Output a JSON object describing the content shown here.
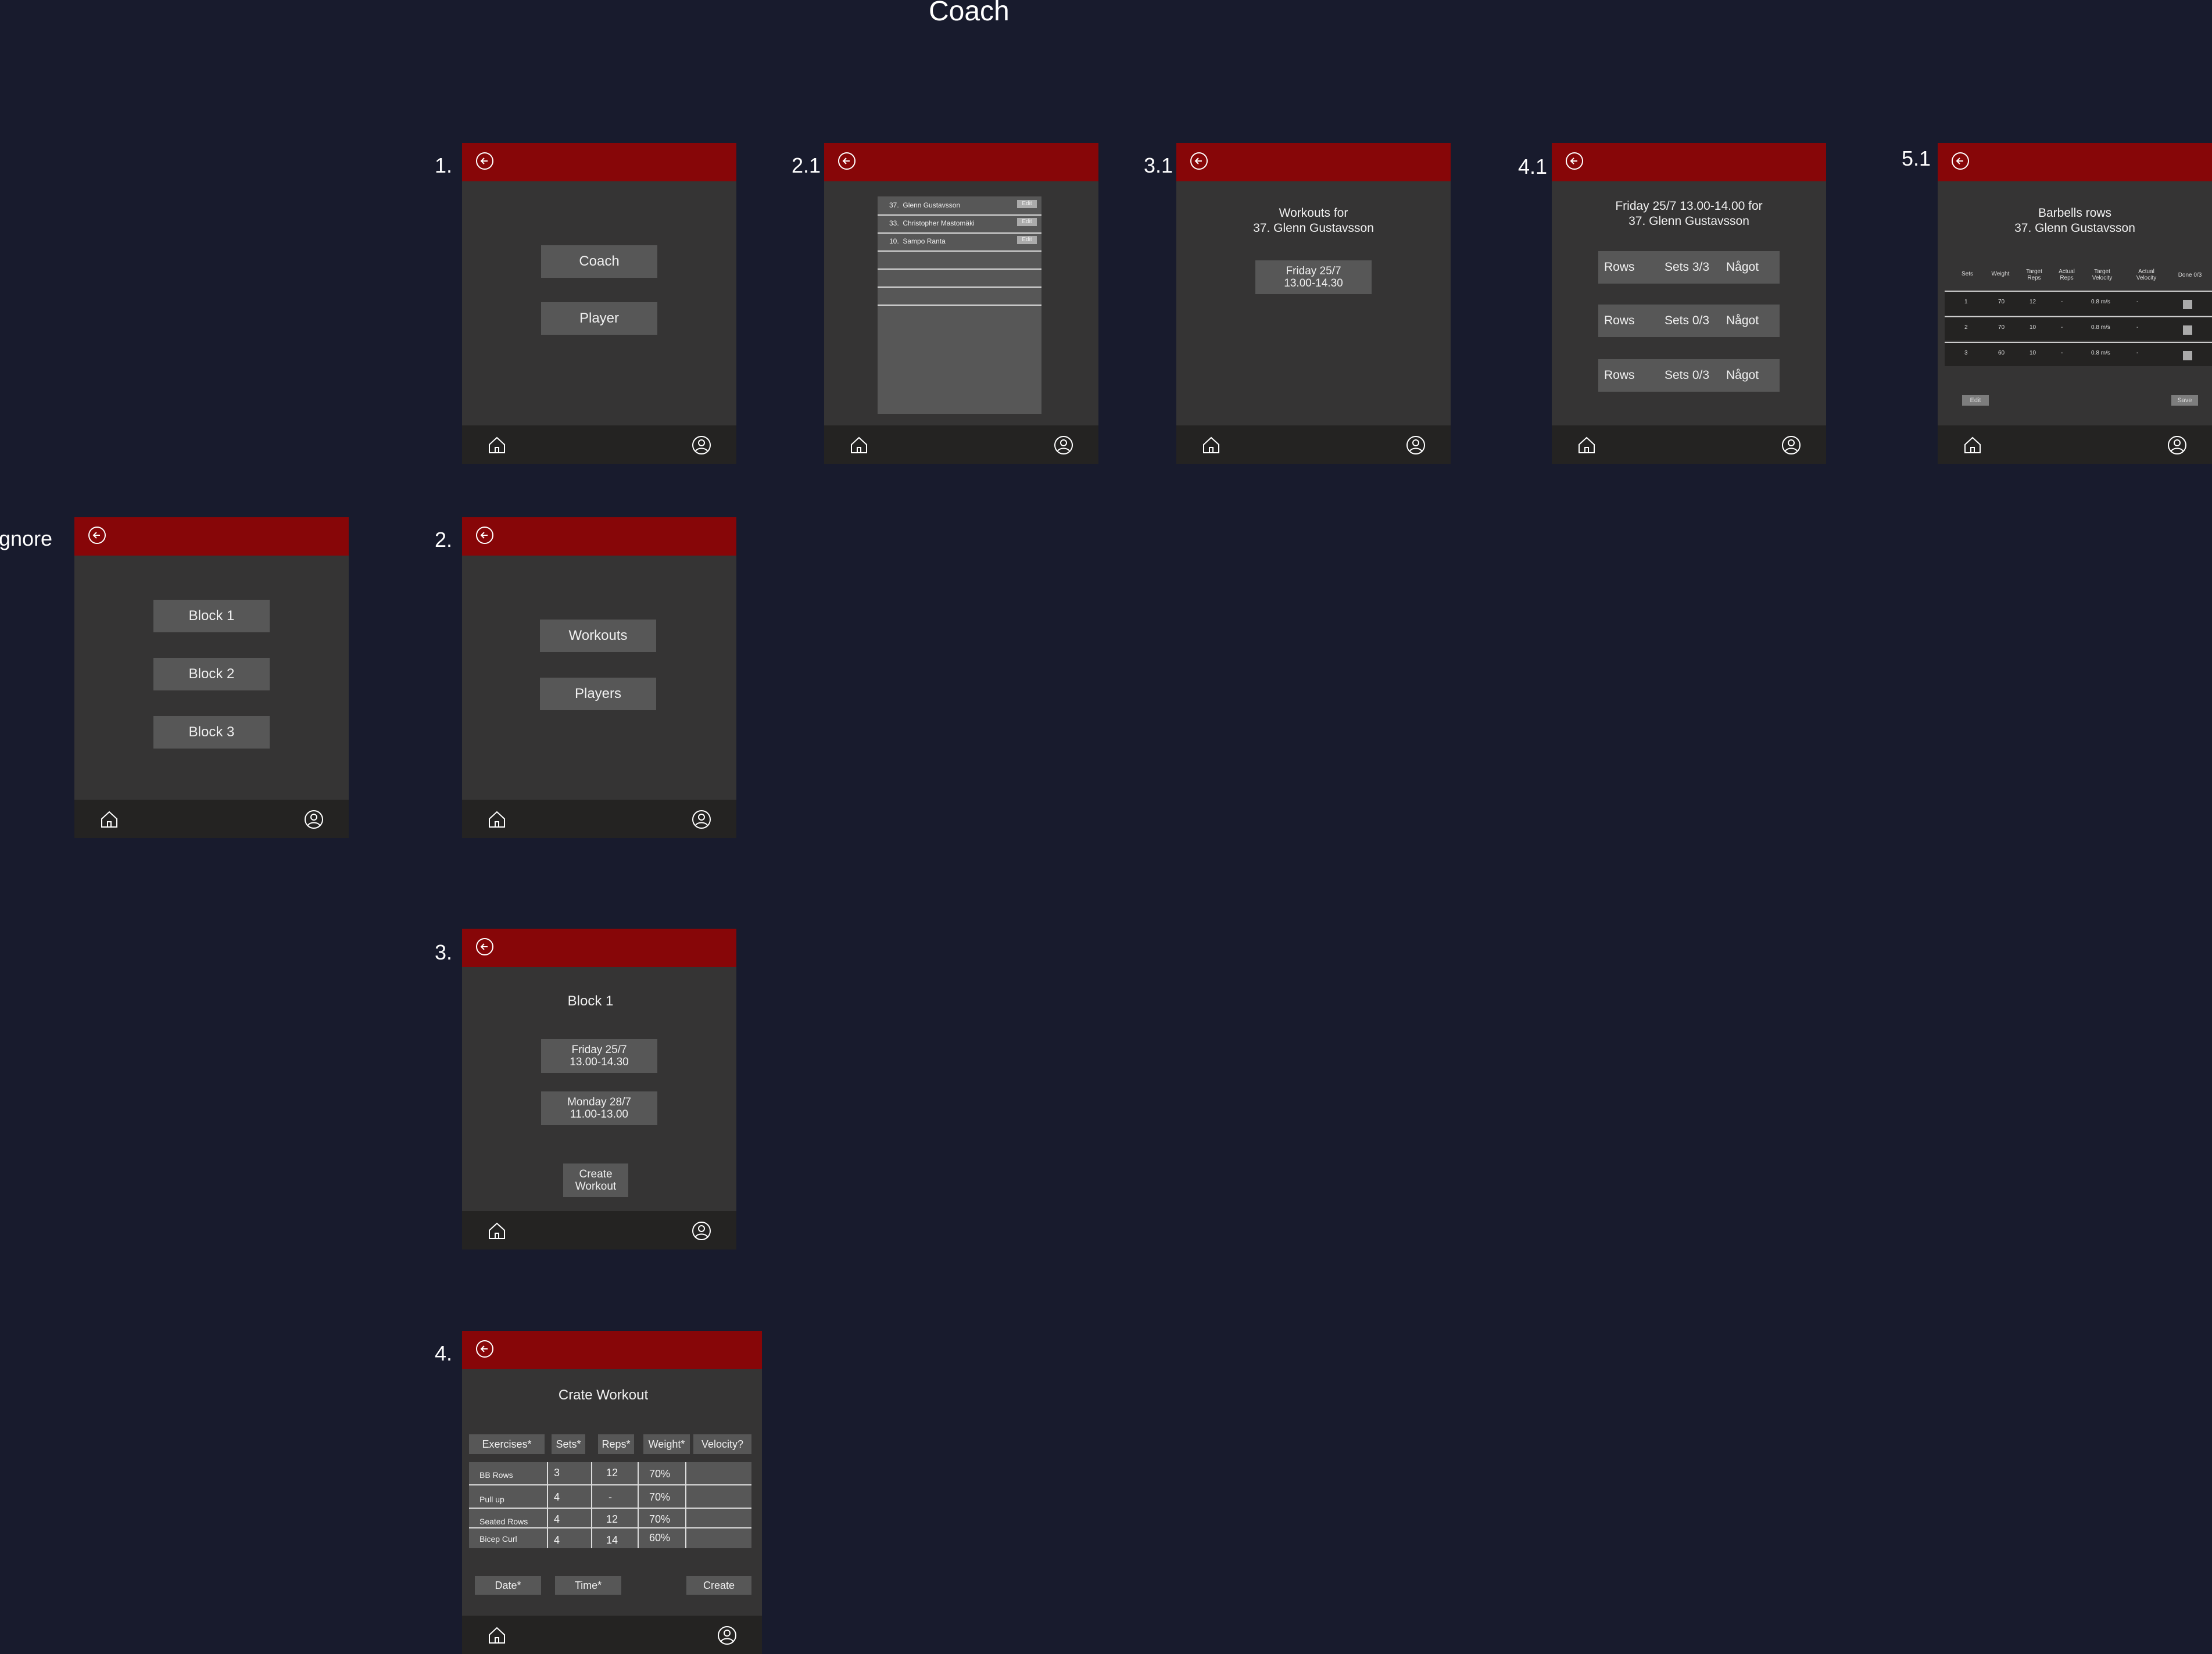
{
  "canvas": {
    "title": "Coach"
  },
  "icons": {
    "back": "back-arrow-icon",
    "home": "home-icon",
    "profile": "profile-icon"
  },
  "colors": {
    "background": "#181b2d",
    "topbar": "#870608",
    "screen": "#353434",
    "bottombar": "#242322",
    "button": "#575757"
  },
  "labels": {
    "s1": "1.",
    "s21": "2.1",
    "s31": "3.1",
    "s41": "4.1",
    "s51": "5.1",
    "ignore": "Ignore",
    "s2": "2.",
    "s3": "3.",
    "s4": "4."
  },
  "screen1": {
    "coach": "Coach",
    "player": "Player"
  },
  "screen21": {
    "players": [
      {
        "number": "37.",
        "name": "Glenn Gustavsson",
        "edit": "Edit"
      },
      {
        "number": "33.",
        "name": "Christopher Mastomäki",
        "edit": "Edit"
      },
      {
        "number": "10.",
        "name": "Sampo Ranta",
        "edit": "Edit"
      }
    ]
  },
  "screen31": {
    "title_line1": "Workouts for",
    "title_line2": "37. Glenn Gustavsson",
    "workout_line1": "Friday 25/7",
    "workout_line2": "13.00-14.30"
  },
  "screen41": {
    "title_line1": "Friday 25/7 13.00-14.00 for",
    "title_line2": "37. Glenn Gustavsson",
    "rows": [
      {
        "name": "Rows",
        "sets": "Sets 3/3",
        "extra": "Något"
      },
      {
        "name": "Rows",
        "sets": "Sets 0/3",
        "extra": "Något"
      },
      {
        "name": "Rows",
        "sets": "Sets 0/3",
        "extra": "Något"
      }
    ]
  },
  "screen51": {
    "title_line1": "Barbells rows",
    "title_line2": "37. Glenn Gustavsson",
    "headers": [
      "Sets",
      "Weight",
      "Target Reps",
      "Actual Reps",
      "Target Velocity",
      "Actual Velocity",
      "Done 0/3"
    ],
    "rows": [
      {
        "set": "1",
        "weight": "70",
        "target_reps": "12",
        "actual_reps": "-",
        "target_velocity": "0.8 m/s",
        "actual_velocity": "-"
      },
      {
        "set": "2",
        "weight": "70",
        "target_reps": "10",
        "actual_reps": "-",
        "target_velocity": "0.8 m/s",
        "actual_velocity": "-"
      },
      {
        "set": "3",
        "weight": "60",
        "target_reps": "10",
        "actual_reps": "-",
        "target_velocity": "0.8 m/s",
        "actual_velocity": "-"
      }
    ],
    "edit": "Edit",
    "save": "Save"
  },
  "ignore_screen": {
    "block1": "Block 1",
    "block2": "Block 2",
    "block3": "Block 3"
  },
  "screen2": {
    "workouts": "Workouts",
    "players": "Players"
  },
  "screen3": {
    "title": "Block 1",
    "w1_line1": "Friday 25/7",
    "w1_line2": "13.00-14.30",
    "w2_line1": "Monday 28/7",
    "w2_line2": "11.00-13.00",
    "create_line1": "Create",
    "create_line2": "Workout"
  },
  "screen4": {
    "title": "Crate Workout",
    "headers": [
      "Exercises*",
      "Sets*",
      "Reps*",
      "Weight*",
      "Velocity?"
    ],
    "rows": [
      {
        "exercise": "BB Rows",
        "sets": "3",
        "reps": "12",
        "weight": "70%"
      },
      {
        "exercise": "Pull up",
        "sets": "4",
        "reps": "-",
        "weight": "70%"
      },
      {
        "exercise": "Seated Rows",
        "sets": "4",
        "reps": "12",
        "weight": "70%"
      },
      {
        "exercise": "Bicep Curl",
        "sets": "4",
        "reps": "14",
        "weight": "60%"
      }
    ],
    "date": "Date*",
    "time": "Time*",
    "create": "Create"
  }
}
